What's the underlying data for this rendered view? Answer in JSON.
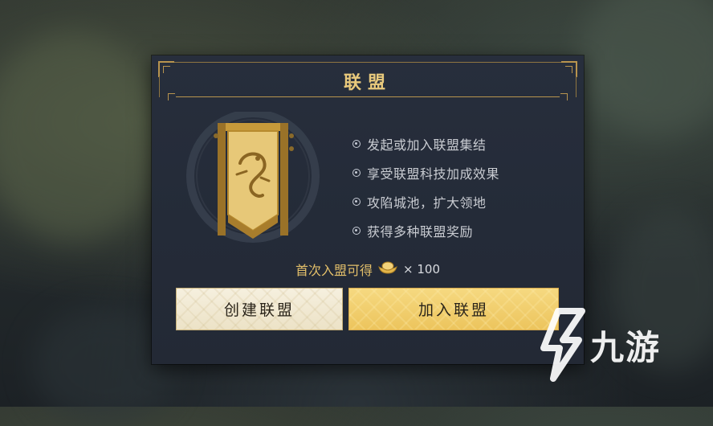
{
  "dialog": {
    "title": "联盟",
    "benefits": [
      "发起或加入联盟集结",
      "享受联盟科技加成效果",
      "攻陷城池，扩大领地",
      "获得多种联盟奖励"
    ],
    "reward": {
      "label": "首次入盟可得",
      "icon": "gold-ingot-icon",
      "quantity": "× 100"
    },
    "buttons": {
      "create": "创建联盟",
      "join": "加入联盟"
    }
  },
  "watermark": {
    "text": "九游"
  },
  "colors": {
    "gold_accent": "#b8944e",
    "title_gold": "#e8c97c",
    "join_button": "#f0cb66",
    "create_button": "#f2ead4",
    "panel_bg": "#252c39"
  }
}
